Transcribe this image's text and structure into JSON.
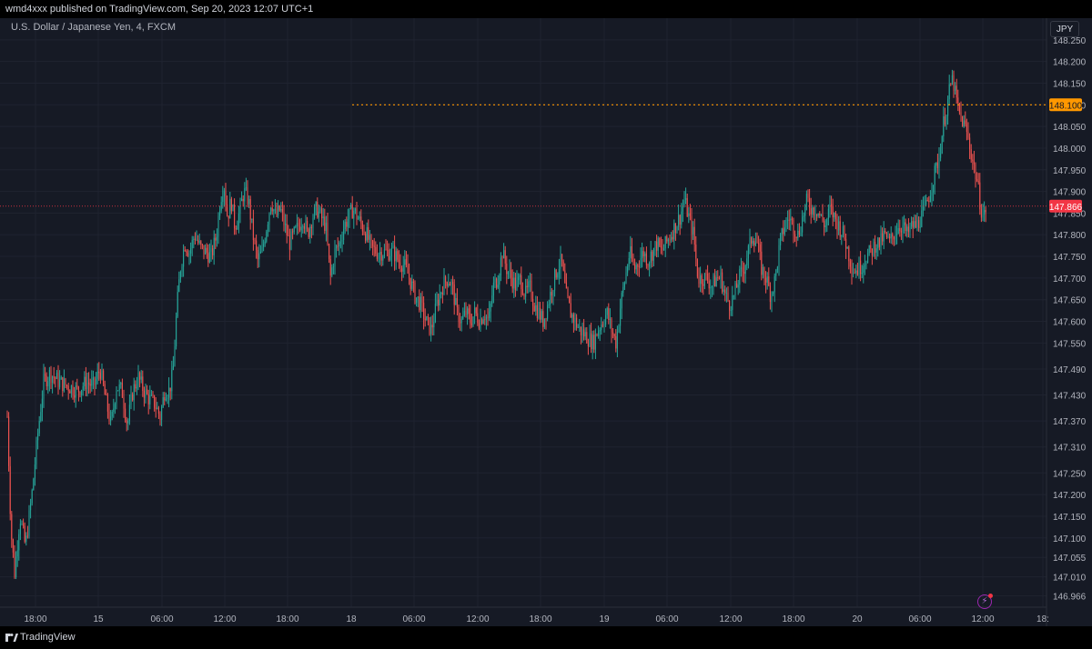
{
  "header": {
    "published": "wmd4xxx published on TradingView.com, Sep 20, 2023 12:07 UTC+1"
  },
  "symbol": {
    "title": "U.S. Dollar / Japanese Yen, 4, FXCM",
    "currency_button": "JPY"
  },
  "footer": {
    "brand": "TradingView"
  },
  "colors": {
    "background": "#161a25",
    "grid": "#1f2330",
    "up": "#26a69a",
    "down": "#ef5350",
    "alert_line": "#ff9800",
    "last_price": "#f23645",
    "axis_text": "#b2b5be"
  },
  "icons": {
    "alert": "bolt-icon",
    "logo": "tradingview-logo-icon"
  },
  "chart_data": {
    "type": "candlestick",
    "title": "",
    "ylim": [
      146.94,
      148.3
    ],
    "xlim": [
      0,
      1150
    ],
    "y_ticks": [
      "148.250",
      "148.200",
      "148.150",
      "148.100",
      "148.050",
      "148.000",
      "147.950",
      "147.900",
      "147.850",
      "147.800",
      "147.750",
      "147.700",
      "147.650",
      "147.600",
      "147.550",
      "147.490",
      "147.430",
      "147.370",
      "147.310",
      "147.250",
      "147.200",
      "147.150",
      "147.100",
      "147.055",
      "147.010",
      "146.966"
    ],
    "x_ticks": [
      {
        "label": "18:00",
        "x": 39
      },
      {
        "label": "15",
        "x": 108
      },
      {
        "label": "06:00",
        "x": 178
      },
      {
        "label": "12:00",
        "x": 247
      },
      {
        "label": "18:00",
        "x": 316
      },
      {
        "label": "18",
        "x": 386
      },
      {
        "label": "06:00",
        "x": 455
      },
      {
        "label": "12:00",
        "x": 525
      },
      {
        "label": "18:00",
        "x": 594
      },
      {
        "label": "19",
        "x": 664
      },
      {
        "label": "06:00",
        "x": 733
      },
      {
        "label": "12:00",
        "x": 803
      },
      {
        "label": "18:00",
        "x": 872
      },
      {
        "label": "20",
        "x": 942
      },
      {
        "label": "06:00",
        "x": 1011
      },
      {
        "label": "12:00",
        "x": 1080
      },
      {
        "label": "18:",
        "x": 1146
      }
    ],
    "price_path": [
      [
        8,
        147.38
      ],
      [
        12,
        147.12
      ],
      [
        16,
        147.02
      ],
      [
        22,
        147.15
      ],
      [
        28,
        147.08
      ],
      [
        35,
        147.2
      ],
      [
        42,
        147.35
      ],
      [
        48,
        147.46
      ],
      [
        55,
        147.48
      ],
      [
        65,
        147.46
      ],
      [
        75,
        147.45
      ],
      [
        85,
        147.44
      ],
      [
        95,
        147.46
      ],
      [
        103,
        147.45
      ],
      [
        110,
        147.49
      ],
      [
        116,
        147.42
      ],
      [
        122,
        147.36
      ],
      [
        128,
        147.45
      ],
      [
        134,
        147.44
      ],
      [
        140,
        147.36
      ],
      [
        146,
        147.44
      ],
      [
        152,
        147.47
      ],
      [
        158,
        147.44
      ],
      [
        164,
        147.42
      ],
      [
        170,
        147.41
      ],
      [
        176,
        147.38
      ],
      [
        181,
        147.44
      ],
      [
        186,
        147.44
      ],
      [
        190,
        147.48
      ],
      [
        194,
        147.62
      ],
      [
        198,
        147.72
      ],
      [
        203,
        147.78
      ],
      [
        208,
        147.76
      ],
      [
        214,
        147.8
      ],
      [
        220,
        147.77
      ],
      [
        226,
        147.76
      ],
      [
        232,
        147.75
      ],
      [
        238,
        147.8
      ],
      [
        242,
        147.88
      ],
      [
        246,
        147.92
      ],
      [
        250,
        147.84
      ],
      [
        254,
        147.88
      ],
      [
        258,
        147.82
      ],
      [
        263,
        147.85
      ],
      [
        268,
        147.9
      ],
      [
        273,
        147.88
      ],
      [
        278,
        147.8
      ],
      [
        283,
        147.74
      ],
      [
        288,
        147.76
      ],
      [
        293,
        147.82
      ],
      [
        298,
        147.88
      ],
      [
        303,
        147.84
      ],
      [
        308,
        147.86
      ],
      [
        313,
        147.82
      ],
      [
        318,
        147.78
      ],
      [
        323,
        147.8
      ],
      [
        328,
        147.82
      ],
      [
        333,
        147.84
      ],
      [
        338,
        147.8
      ],
      [
        343,
        147.84
      ],
      [
        348,
        147.86
      ],
      [
        353,
        147.84
      ],
      [
        358,
        147.82
      ],
      [
        363,
        147.7
      ],
      [
        368,
        147.76
      ],
      [
        373,
        147.78
      ],
      [
        378,
        147.82
      ],
      [
        383,
        147.84
      ],
      [
        388,
        147.86
      ],
      [
        393,
        147.84
      ],
      [
        398,
        147.82
      ],
      [
        403,
        147.8
      ],
      [
        408,
        147.77
      ],
      [
        414,
        147.76
      ],
      [
        420,
        147.76
      ],
      [
        426,
        147.76
      ],
      [
        432,
        147.76
      ],
      [
        438,
        147.74
      ],
      [
        444,
        147.73
      ],
      [
        450,
        147.7
      ],
      [
        456,
        147.66
      ],
      [
        462,
        147.64
      ],
      [
        468,
        147.6
      ],
      [
        474,
        147.58
      ],
      [
        480,
        147.64
      ],
      [
        486,
        147.68
      ],
      [
        492,
        147.7
      ],
      [
        497,
        147.68
      ],
      [
        502,
        147.62
      ],
      [
        507,
        147.6
      ],
      [
        512,
        147.62
      ],
      [
        517,
        147.6
      ],
      [
        522,
        147.62
      ],
      [
        527,
        147.6
      ],
      [
        532,
        147.62
      ],
      [
        537,
        147.6
      ],
      [
        542,
        147.68
      ],
      [
        547,
        147.7
      ],
      [
        552,
        147.76
      ],
      [
        557,
        147.72
      ],
      [
        562,
        147.7
      ],
      [
        567,
        147.68
      ],
      [
        572,
        147.7
      ],
      [
        577,
        147.66
      ],
      [
        582,
        147.68
      ],
      [
        587,
        147.64
      ],
      [
        592,
        147.62
      ],
      [
        597,
        147.6
      ],
      [
        602,
        147.64
      ],
      [
        607,
        147.68
      ],
      [
        612,
        147.72
      ],
      [
        617,
        147.74
      ],
      [
        622,
        147.66
      ],
      [
        627,
        147.62
      ],
      [
        632,
        147.6
      ],
      [
        637,
        147.58
      ],
      [
        642,
        147.57
      ],
      [
        647,
        147.56
      ],
      [
        652,
        147.55
      ],
      [
        657,
        147.58
      ],
      [
        662,
        147.6
      ],
      [
        667,
        147.62
      ],
      [
        672,
        147.58
      ],
      [
        677,
        147.55
      ],
      [
        682,
        147.64
      ],
      [
        687,
        147.7
      ],
      [
        692,
        147.76
      ],
      [
        697,
        147.72
      ],
      [
        702,
        147.74
      ],
      [
        707,
        147.76
      ],
      [
        712,
        147.74
      ],
      [
        717,
        147.76
      ],
      [
        722,
        147.78
      ],
      [
        727,
        147.76
      ],
      [
        732,
        147.78
      ],
      [
        737,
        147.8
      ],
      [
        742,
        147.82
      ],
      [
        747,
        147.84
      ],
      [
        752,
        147.88
      ],
      [
        757,
        147.84
      ],
      [
        762,
        147.8
      ],
      [
        767,
        147.7
      ],
      [
        772,
        147.7
      ],
      [
        777,
        147.7
      ],
      [
        782,
        147.68
      ],
      [
        787,
        147.7
      ],
      [
        792,
        147.7
      ],
      [
        797,
        147.66
      ],
      [
        802,
        147.64
      ],
      [
        807,
        147.66
      ],
      [
        812,
        147.7
      ],
      [
        817,
        147.72
      ],
      [
        822,
        147.76
      ],
      [
        827,
        147.8
      ],
      [
        832,
        147.78
      ],
      [
        837,
        147.72
      ],
      [
        842,
        147.7
      ],
      [
        847,
        147.66
      ],
      [
        852,
        147.7
      ],
      [
        857,
        147.78
      ],
      [
        862,
        147.82
      ],
      [
        867,
        147.84
      ],
      [
        872,
        147.82
      ],
      [
        877,
        147.8
      ],
      [
        882,
        147.84
      ],
      [
        887,
        147.88
      ],
      [
        892,
        147.86
      ],
      [
        897,
        147.86
      ],
      [
        902,
        147.84
      ],
      [
        907,
        147.82
      ],
      [
        912,
        147.86
      ],
      [
        917,
        147.84
      ],
      [
        922,
        147.82
      ],
      [
        927,
        147.8
      ],
      [
        932,
        147.76
      ],
      [
        937,
        147.72
      ],
      [
        942,
        147.72
      ],
      [
        947,
        147.73
      ],
      [
        952,
        147.75
      ],
      [
        957,
        147.76
      ],
      [
        962,
        147.78
      ],
      [
        967,
        147.78
      ],
      [
        972,
        147.8
      ],
      [
        977,
        147.78
      ],
      [
        982,
        147.8
      ],
      [
        987,
        147.82
      ],
      [
        992,
        147.82
      ],
      [
        997,
        147.8
      ],
      [
        1002,
        147.82
      ],
      [
        1007,
        147.82
      ],
      [
        1012,
        147.84
      ],
      [
        1017,
        147.86
      ],
      [
        1022,
        147.9
      ],
      [
        1027,
        147.94
      ],
      [
        1032,
        147.98
      ],
      [
        1037,
        148.06
      ],
      [
        1041,
        148.1
      ],
      [
        1044,
        148.14
      ],
      [
        1047,
        148.16
      ],
      [
        1050,
        148.12
      ],
      [
        1054,
        148.08
      ],
      [
        1058,
        148.06
      ],
      [
        1062,
        148.04
      ],
      [
        1066,
        148.0
      ],
      [
        1070,
        147.96
      ],
      [
        1074,
        147.92
      ],
      [
        1078,
        147.86
      ],
      [
        1081,
        147.84
      ],
      [
        1084,
        147.866
      ]
    ],
    "alert_line": {
      "price": 148.1,
      "label": "148.100",
      "from_x": 387
    },
    "last_price": {
      "price": 147.866,
      "label": "147.866"
    }
  }
}
